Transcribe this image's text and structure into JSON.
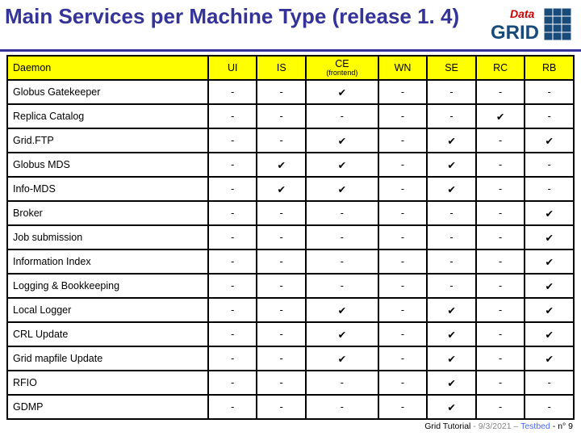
{
  "title": "Main Services per Machine Type (release 1. 4)",
  "logo": {
    "brand_top": "Data",
    "brand_bot": "GRID"
  },
  "table": {
    "header": [
      "Daemon",
      "UI",
      "IS",
      "CE",
      "WN",
      "SE",
      "RC",
      "RB"
    ],
    "ce_sub": "(frontend)",
    "rows": [
      {
        "name": "Globus Gatekeeper",
        "cells": [
          "-",
          "-",
          "✔",
          "-",
          "-",
          "-",
          "-"
        ]
      },
      {
        "name": "Replica Catalog",
        "cells": [
          "-",
          "-",
          "-",
          "-",
          "-",
          "✔",
          "-"
        ]
      },
      {
        "name": "Grid.FTP",
        "cells": [
          "-",
          "-",
          "✔",
          "-",
          "✔",
          "-",
          "✔"
        ]
      },
      {
        "name": "Globus MDS",
        "cells": [
          "-",
          "✔",
          "✔",
          "-",
          "✔",
          "-",
          "-"
        ]
      },
      {
        "name": "Info-MDS",
        "cells": [
          "-",
          "✔",
          "✔",
          "-",
          "✔",
          "-",
          "-"
        ]
      },
      {
        "name": "Broker",
        "cells": [
          "-",
          "-",
          "-",
          "-",
          "-",
          "-",
          "✔"
        ]
      },
      {
        "name": "Job submission",
        "cells": [
          "-",
          "-",
          "-",
          "-",
          "-",
          "-",
          "✔"
        ]
      },
      {
        "name": "Information Index",
        "cells": [
          "-",
          "-",
          "-",
          "-",
          "-",
          "-",
          "✔"
        ]
      },
      {
        "name": "Logging & Bookkeeping",
        "cells": [
          "-",
          "-",
          "-",
          "-",
          "-",
          "-",
          "✔"
        ]
      },
      {
        "name": "Local Logger",
        "cells": [
          "-",
          "-",
          "✔",
          "-",
          "✔",
          "-",
          "✔"
        ]
      },
      {
        "name": "CRL Update",
        "cells": [
          "-",
          "-",
          "✔",
          "-",
          "✔",
          "-",
          "✔"
        ]
      },
      {
        "name": "Grid mapfile Update",
        "cells": [
          "-",
          "-",
          "✔",
          "-",
          "✔",
          "-",
          "✔"
        ]
      },
      {
        "name": "RFIO",
        "cells": [
          "-",
          "-",
          "-",
          "-",
          "✔",
          "-",
          "-"
        ]
      },
      {
        "name": "GDMP",
        "cells": [
          "-",
          "-",
          "-",
          "-",
          "✔",
          "-",
          "-"
        ]
      }
    ]
  },
  "footer": {
    "p1": "Grid Tutorial",
    "p2": " - 9/3/2021 – ",
    "p3": "Testbed",
    "p4": " - n° 9"
  }
}
